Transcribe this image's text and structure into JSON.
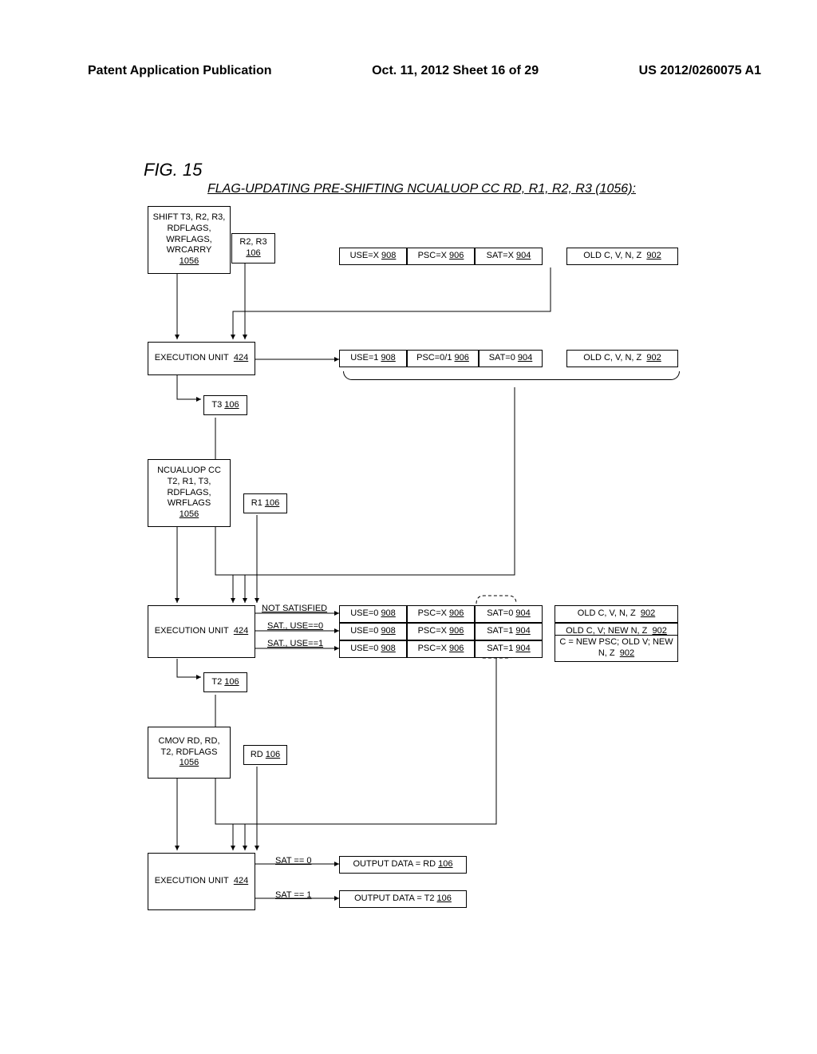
{
  "header": {
    "left": "Patent Application Publication",
    "middle": "Oct. 11, 2012  Sheet 16 of 29",
    "right": "US 2012/0260075 A1"
  },
  "fig_label": "FIG. 15",
  "title": "FLAG-UPDATING PRE-SHIFTING NCUALUOP CC RD, R1, R2, R3 (1056):",
  "boxes": {
    "shift_op": "SHIFT T3, R2, R3, RDFLAGS, WRFLAGS, WRCARRY",
    "shift_op_ref": "1056",
    "r2r3": "R2, R3",
    "r2r3_ref": "106",
    "use_row1": "USE=X",
    "use_row1_ref": "908",
    "psc_row1": "PSC=X",
    "psc_row1_ref": "906",
    "sat_row1": "SAT=X",
    "sat_row1_ref": "904",
    "flags_row1": "OLD C, V, N, Z",
    "flags_row1_ref": "902",
    "exec1": "EXECUTION UNIT",
    "exec1_ref": "424",
    "use_row2": "USE=1",
    "use_row2_ref": "908",
    "psc_row2": "PSC=0/1",
    "psc_row2_ref": "906",
    "sat_row2": "SAT=0",
    "sat_row2_ref": "904",
    "flags_row2": "OLD C, V, N, Z",
    "flags_row2_ref": "902",
    "t3": "T3",
    "t3_ref": "106",
    "ncu_op": "NCUALUOP CC T2, R1, T3, RDFLAGS, WRFLAGS",
    "ncu_op_ref": "1056",
    "r1": "R1",
    "r1_ref": "106",
    "edge_ns": "NOT SATISFIED",
    "edge_s0": "SAT., USE==0",
    "edge_s1": "SAT., USE==1",
    "use3a": "USE=0",
    "use3a_ref": "908",
    "psc3a": "PSC=X",
    "psc3a_ref": "906",
    "sat3a": "SAT=0",
    "sat3a_ref": "904",
    "flags3a": "OLD C, V, N, Z",
    "flags3a_ref": "902",
    "use3b": "USE=0",
    "use3b_ref": "908",
    "psc3b": "PSC=X",
    "psc3b_ref": "906",
    "sat3b": "SAT=1",
    "sat3b_ref": "904",
    "flags3b": "OLD C, V;  NEW N, Z",
    "flags3b_ref": "902",
    "use3c": "USE=0",
    "use3c_ref": "908",
    "psc3c": "PSC=X",
    "psc3c_ref": "906",
    "sat3c": "SAT=1",
    "sat3c_ref": "904",
    "flags3c": "C = NEW PSC; OLD V; NEW N, Z",
    "flags3c_ref": "902",
    "exec2": "EXECUTION UNIT",
    "exec2_ref": "424",
    "t2": "T2",
    "t2_ref": "106",
    "cmov_op": "CMOV RD, RD, T2, RDFLAGS",
    "cmov_op_ref": "1056",
    "rd": "RD",
    "rd_ref": "106",
    "exec3": "EXECUTION UNIT",
    "exec3_ref": "424",
    "edge_sat0": "SAT == 0",
    "edge_sat1": "SAT == 1",
    "out_rd": "OUTPUT DATA = RD",
    "out_rd_ref": "106",
    "out_t2": "OUTPUT DATA = T2",
    "out_t2_ref": "106"
  }
}
